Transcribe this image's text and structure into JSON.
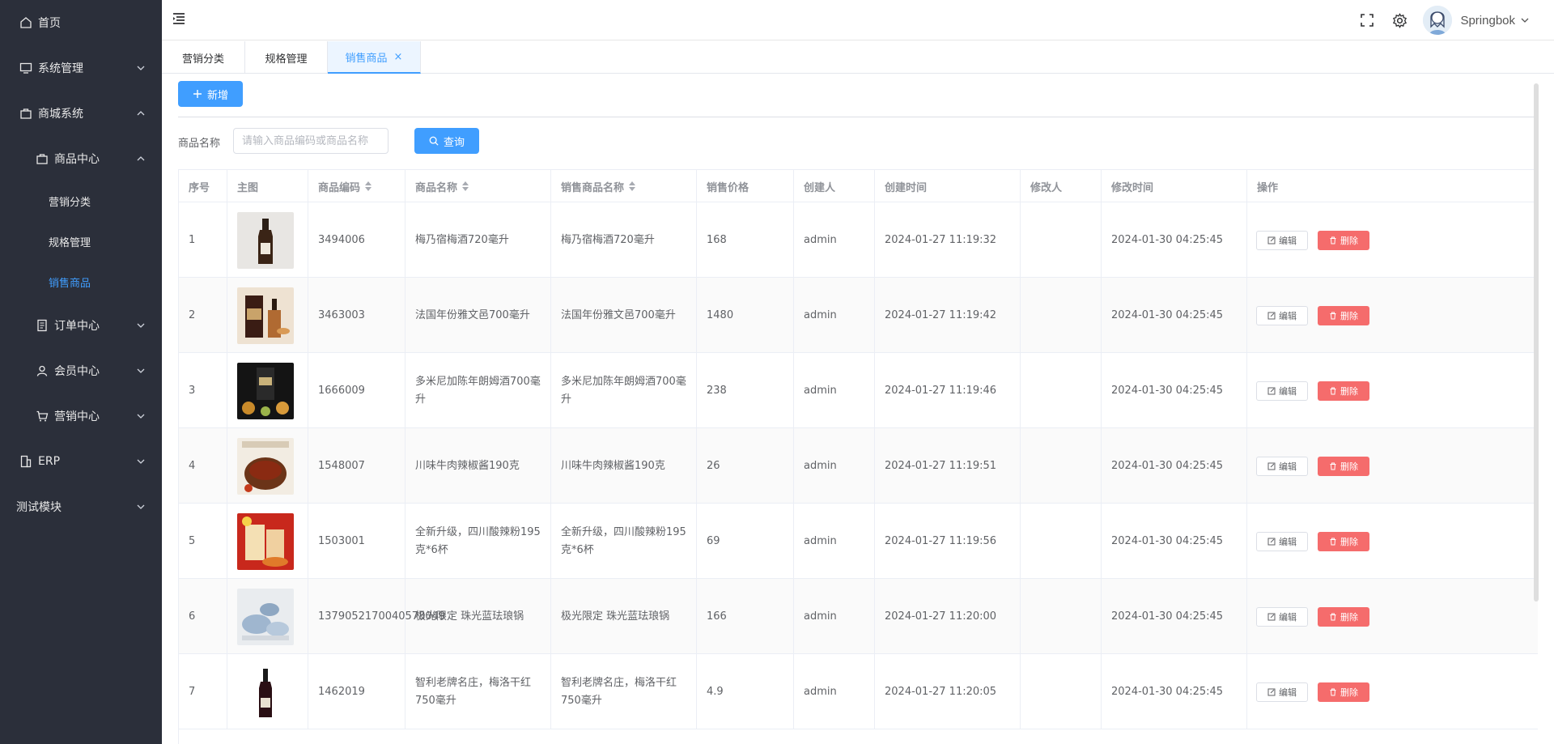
{
  "sidebar": {
    "items": [
      {
        "label": "首页",
        "icon": "home-icon",
        "expanded": false
      },
      {
        "label": "系统管理",
        "icon": "monitor-icon",
        "expanded": false
      },
      {
        "label": "商城系统",
        "icon": "shop-icon",
        "expanded": true
      },
      {
        "label": "商品中心",
        "icon": "bag-icon",
        "expanded": true
      },
      {
        "label": "营销分类"
      },
      {
        "label": "规格管理"
      },
      {
        "label": "销售商品",
        "active": true
      },
      {
        "label": "订单中心",
        "icon": "document-icon",
        "expanded": false
      },
      {
        "label": "会员中心",
        "icon": "user-icon",
        "expanded": false
      },
      {
        "label": "营销中心",
        "icon": "cart-icon",
        "expanded": false
      },
      {
        "label": "ERP",
        "icon": "building-icon",
        "expanded": false
      },
      {
        "label": "测试模块",
        "expanded": false
      }
    ]
  },
  "header": {
    "username": "Springbok",
    "icons": [
      "fullscreen-icon",
      "gear-icon"
    ]
  },
  "tabs": [
    {
      "label": "营销分类"
    },
    {
      "label": "规格管理"
    },
    {
      "label": "销售商品",
      "active": true,
      "close": "×"
    }
  ],
  "toolbar": {
    "add_label": "新增"
  },
  "search": {
    "label": "商品名称",
    "placeholder": "请输入商品编码或商品名称",
    "button_label": "查询"
  },
  "table": {
    "columns": [
      "序号",
      "主图",
      "商品编码",
      "商品名称",
      "销售商品名称",
      "销售价格",
      "创建人",
      "创建时间",
      "修改人",
      "修改时间",
      "操作"
    ],
    "edit_label": "编辑",
    "delete_label": "删除",
    "rows": [
      {
        "index": "1",
        "code": "3494006",
        "name": "梅乃宿梅酒720毫升",
        "sale_name": "梅乃宿梅酒720毫升",
        "price": "168",
        "creator": "admin",
        "created": "2024-01-27 11:19:32",
        "modifier": "",
        "modified": "2024-01-30 04:25:45"
      },
      {
        "index": "2",
        "code": "3463003",
        "name": "法国年份雅文邑700毫升",
        "sale_name": "法国年份雅文邑700毫升",
        "price": "1480",
        "creator": "admin",
        "created": "2024-01-27 11:19:42",
        "modifier": "",
        "modified": "2024-01-30 04:25:45"
      },
      {
        "index": "3",
        "code": "1666009",
        "name": "多米尼加陈年朗姆酒700毫升",
        "sale_name": "多米尼加陈年朗姆酒700毫升",
        "price": "238",
        "creator": "admin",
        "created": "2024-01-27 11:19:46",
        "modifier": "",
        "modified": "2024-01-30 04:25:45"
      },
      {
        "index": "4",
        "code": "1548007",
        "name": "川味牛肉辣椒酱190克",
        "sale_name": "川味牛肉辣椒酱190克",
        "price": "26",
        "creator": "admin",
        "created": "2024-01-27 11:19:51",
        "modifier": "",
        "modified": "2024-01-30 04:25:45"
      },
      {
        "index": "5",
        "code": "1503001",
        "name": "全新升级，四川酸辣粉195克*6杯",
        "sale_name": "全新升级，四川酸辣粉195克*6杯",
        "price": "69",
        "creator": "admin",
        "created": "2024-01-27 11:19:56",
        "modifier": "",
        "modified": "2024-01-30 04:25:45"
      },
      {
        "index": "6",
        "code": "1379052170040578049",
        "name": "极光限定 珠光蓝珐琅锅",
        "sale_name": "极光限定 珠光蓝珐琅锅",
        "price": "166",
        "creator": "admin",
        "created": "2024-01-27 11:20:00",
        "modifier": "",
        "modified": "2024-01-30 04:25:45"
      },
      {
        "index": "7",
        "code": "1462019",
        "name": "智利老牌名庄，梅洛干红750毫升",
        "sale_name": "智利老牌名庄，梅洛干红750毫升",
        "price": "4.9",
        "creator": "admin",
        "created": "2024-01-27 11:20:05",
        "modifier": "",
        "modified": "2024-01-30 04:25:45"
      }
    ]
  },
  "colors": {
    "primary": "#409eff",
    "danger": "#f56c6c",
    "sidebar_bg": "#2b2f3a"
  }
}
